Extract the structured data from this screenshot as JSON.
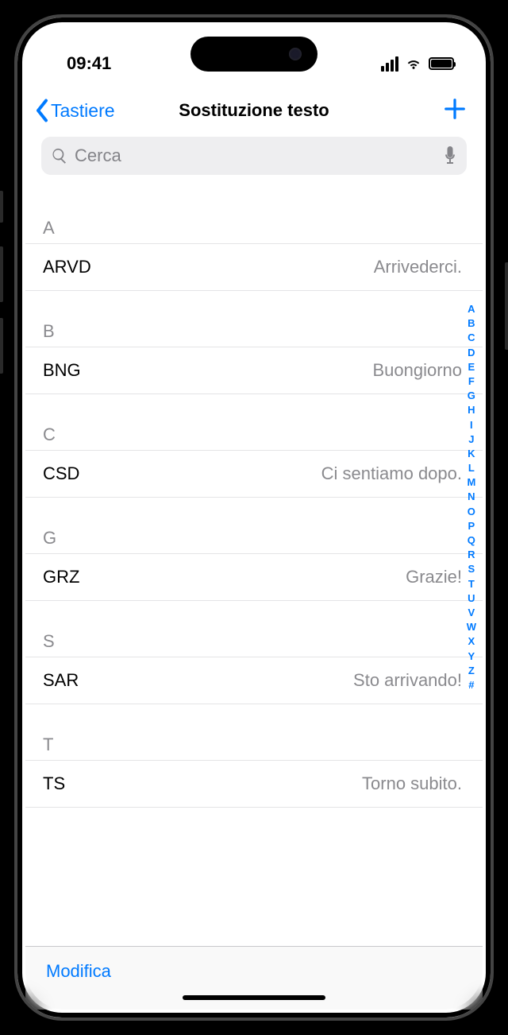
{
  "status": {
    "time": "09:41"
  },
  "nav": {
    "back": "Tastiere",
    "title": "Sostituzione testo"
  },
  "search": {
    "placeholder": "Cerca"
  },
  "sections": [
    {
      "letter": "A",
      "items": [
        {
          "shortcut": "ARVD",
          "phrase": "Arrivederci."
        }
      ]
    },
    {
      "letter": "B",
      "items": [
        {
          "shortcut": "BNG",
          "phrase": "Buongiorno"
        }
      ]
    },
    {
      "letter": "C",
      "items": [
        {
          "shortcut": "CSD",
          "phrase": "Ci sentiamo dopo."
        }
      ]
    },
    {
      "letter": "G",
      "items": [
        {
          "shortcut": "GRZ",
          "phrase": "Grazie!"
        }
      ]
    },
    {
      "letter": "S",
      "items": [
        {
          "shortcut": "SAR",
          "phrase": "Sto arrivando!"
        }
      ]
    },
    {
      "letter": "T",
      "items": [
        {
          "shortcut": "TS",
          "phrase": "Torno subito."
        }
      ]
    }
  ],
  "index": [
    "A",
    "B",
    "C",
    "D",
    "E",
    "F",
    "G",
    "H",
    "I",
    "J",
    "K",
    "L",
    "M",
    "N",
    "O",
    "P",
    "Q",
    "R",
    "S",
    "T",
    "U",
    "V",
    "W",
    "X",
    "Y",
    "Z",
    "#"
  ],
  "toolbar": {
    "edit": "Modifica"
  }
}
